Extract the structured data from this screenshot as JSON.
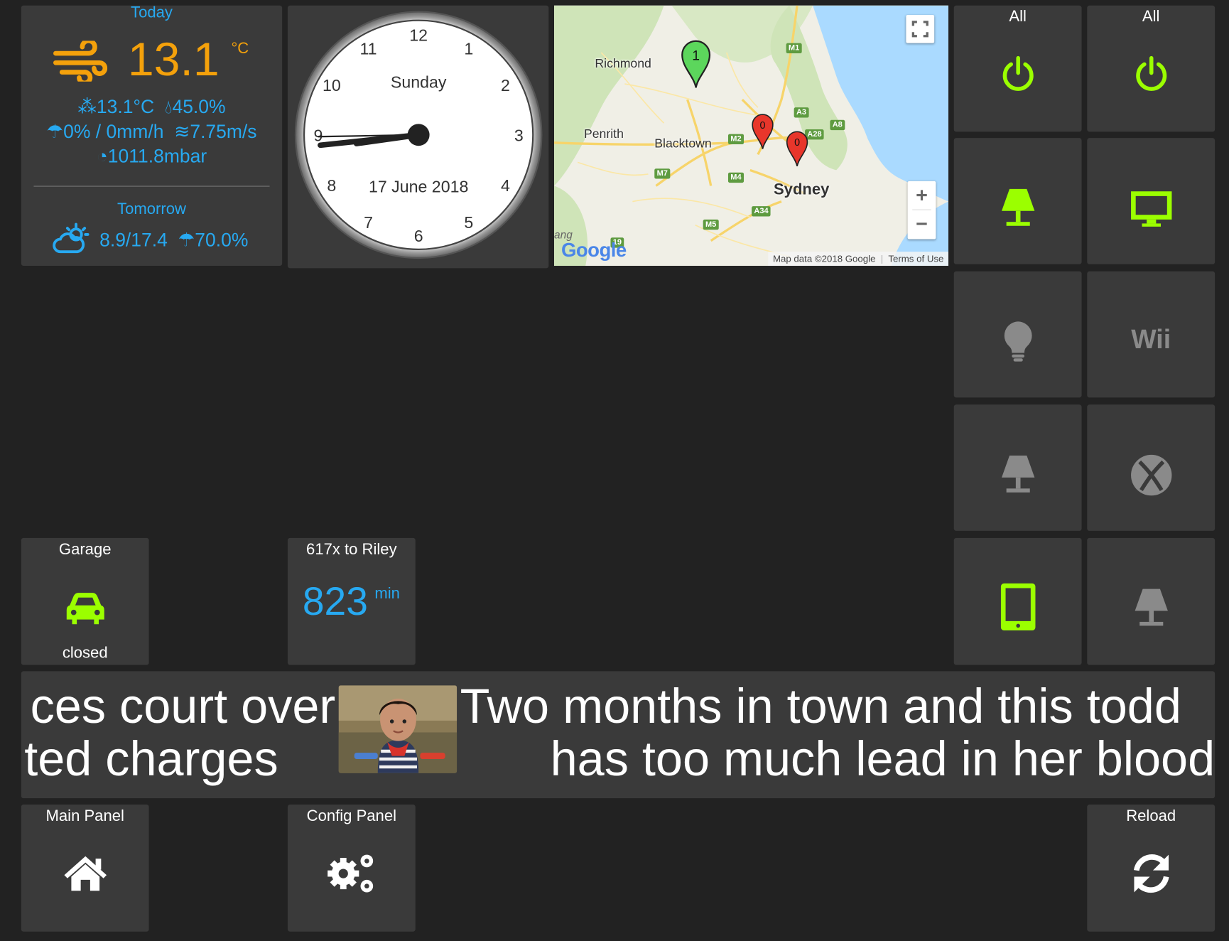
{
  "weather": {
    "today_label": "Today",
    "temperature": "13.1",
    "temp_unit": "°C",
    "feels_like": "13.1°C",
    "humidity": "45.0%",
    "rain": "0% / 0mm/h",
    "wind": "7.75m/s",
    "pressure": "1011.8mbar",
    "tomorrow_label": "Tomorrow",
    "tomorrow_temps": "8.9/17.4",
    "tomorrow_rain": "70.0%",
    "icon": "wind-icon",
    "tomorrow_icon": "partly-cloudy-icon"
  },
  "clock": {
    "day": "Sunday",
    "date": "17 June 2018",
    "numbers": [
      "12",
      "1",
      "2",
      "3",
      "4",
      "5",
      "6",
      "7",
      "8",
      "9",
      "10",
      "11"
    ],
    "time": "08:44"
  },
  "map": {
    "places": [
      "Richmond",
      "Penrith",
      "Blacktown",
      "Sydney"
    ],
    "roads": [
      "M1",
      "A3",
      "A8",
      "A28",
      "M2",
      "M7",
      "M4",
      "A34",
      "M5",
      "19"
    ],
    "markers": [
      {
        "label": "1",
        "color": "#5cd65c"
      },
      {
        "label": "0",
        "color": "#e8362b"
      },
      {
        "label": "0",
        "color": "#e8362b"
      }
    ],
    "zoom_in": "+",
    "zoom_out": "−",
    "logo": "Google",
    "attribution": "Map data ©2018 Google",
    "terms": "Terms of Use",
    "edge_text": "ang"
  },
  "switches": {
    "all_1": {
      "label": "All",
      "icon": "power-icon",
      "state": "on"
    },
    "all_2": {
      "label": "All",
      "icon": "power-icon",
      "state": "on"
    },
    "r2c1": {
      "icon": "lamp-icon",
      "state": "on"
    },
    "r2c2": {
      "icon": "monitor-icon",
      "state": "on"
    },
    "r3c1": {
      "icon": "lightbulb-icon",
      "state": "off"
    },
    "r3c2": {
      "icon": "wii-icon",
      "text": "Wii",
      "state": "off"
    },
    "r4c1": {
      "icon": "lamp-icon",
      "state": "off"
    },
    "r4c2": {
      "icon": "xbox-icon",
      "state": "off"
    },
    "r5c1": {
      "icon": "tablet-icon",
      "state": "on"
    },
    "r5c2": {
      "icon": "lamp-icon",
      "state": "off"
    }
  },
  "garage": {
    "label": "Garage",
    "status": "closed",
    "icon": "car-icon"
  },
  "bus": {
    "label": "617x to Riley",
    "value": "823",
    "unit": "min"
  },
  "news": {
    "left_line1": "ces court over",
    "left_line2": "ted charges",
    "right_line1": "Two months in town and this todd",
    "right_line2": "has too much lead in her blood"
  },
  "nav": {
    "main_panel": "Main Panel",
    "config_panel": "Config Panel",
    "reload": "Reload"
  },
  "colors": {
    "on": "#9bff00",
    "off": "#8a8a8a",
    "accent": "#27a9f1",
    "temp": "#f4a10b",
    "tile": "#3a3a3a",
    "background": "#222222"
  }
}
